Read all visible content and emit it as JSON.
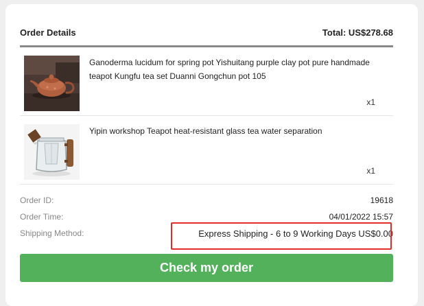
{
  "order": {
    "title": "Order Details",
    "total": "Total: US$278.68"
  },
  "items": [
    {
      "name": "Ganoderma lucidum for spring pot Yishuitang purple clay pot pure handmade teapot Kungfu tea set Duanni Gongchun pot 105",
      "qty": "x1",
      "thumbnail": "purple-clay-teapot"
    },
    {
      "name": "Yipin workshop Teapot heat-resistant glass tea water separation",
      "qty": "x1",
      "thumbnail": "glass-teapot"
    }
  ],
  "info": {
    "order_id_label": "Order ID:",
    "order_id_value": "19618",
    "order_time_label": "Order Time:",
    "order_time_value": "04/01/2022 15:57",
    "shipping_label": "Shipping Method:",
    "shipping_value": "Express Shipping - 6 to 9 Working Days US$0.00"
  },
  "action": {
    "check_order_label": "Check my order"
  },
  "colors": {
    "button": "#52b15a",
    "highlight": "#e52a2a",
    "header_rule": "#888888"
  }
}
